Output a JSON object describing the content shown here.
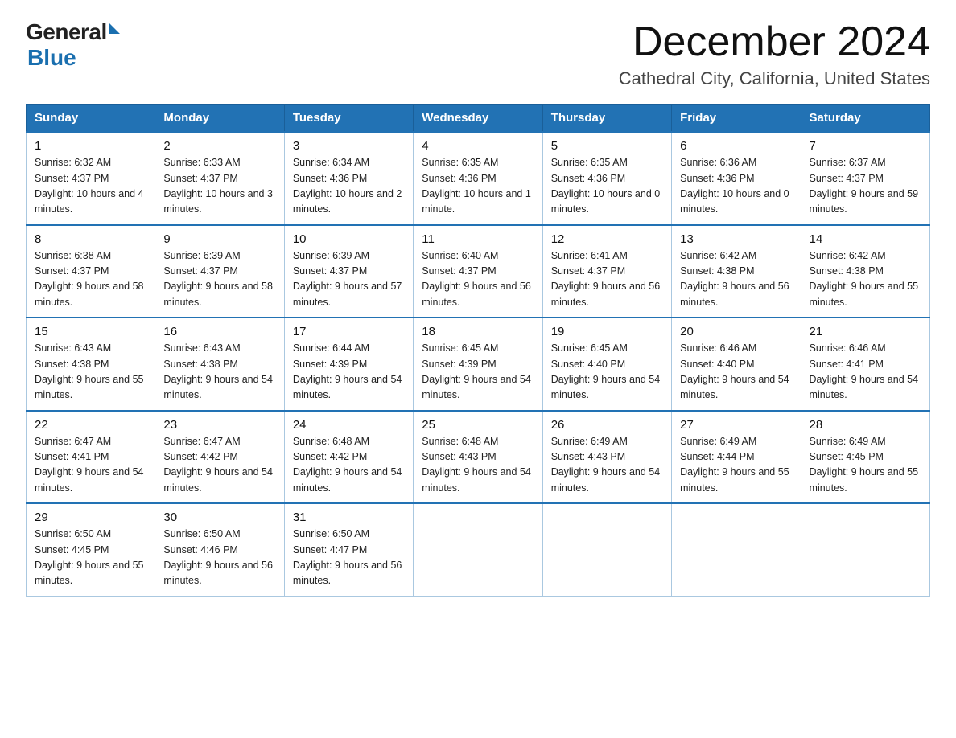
{
  "logo": {
    "general": "General",
    "blue": "Blue"
  },
  "header": {
    "month_title": "December 2024",
    "location": "Cathedral City, California, United States"
  },
  "weekdays": [
    "Sunday",
    "Monday",
    "Tuesday",
    "Wednesday",
    "Thursday",
    "Friday",
    "Saturday"
  ],
  "weeks": [
    [
      {
        "day": "1",
        "sunrise": "6:32 AM",
        "sunset": "4:37 PM",
        "daylight": "10 hours and 4 minutes."
      },
      {
        "day": "2",
        "sunrise": "6:33 AM",
        "sunset": "4:37 PM",
        "daylight": "10 hours and 3 minutes."
      },
      {
        "day": "3",
        "sunrise": "6:34 AM",
        "sunset": "4:36 PM",
        "daylight": "10 hours and 2 minutes."
      },
      {
        "day": "4",
        "sunrise": "6:35 AM",
        "sunset": "4:36 PM",
        "daylight": "10 hours and 1 minute."
      },
      {
        "day": "5",
        "sunrise": "6:35 AM",
        "sunset": "4:36 PM",
        "daylight": "10 hours and 0 minutes."
      },
      {
        "day": "6",
        "sunrise": "6:36 AM",
        "sunset": "4:36 PM",
        "daylight": "10 hours and 0 minutes."
      },
      {
        "day": "7",
        "sunrise": "6:37 AM",
        "sunset": "4:37 PM",
        "daylight": "9 hours and 59 minutes."
      }
    ],
    [
      {
        "day": "8",
        "sunrise": "6:38 AM",
        "sunset": "4:37 PM",
        "daylight": "9 hours and 58 minutes."
      },
      {
        "day": "9",
        "sunrise": "6:39 AM",
        "sunset": "4:37 PM",
        "daylight": "9 hours and 58 minutes."
      },
      {
        "day": "10",
        "sunrise": "6:39 AM",
        "sunset": "4:37 PM",
        "daylight": "9 hours and 57 minutes."
      },
      {
        "day": "11",
        "sunrise": "6:40 AM",
        "sunset": "4:37 PM",
        "daylight": "9 hours and 56 minutes."
      },
      {
        "day": "12",
        "sunrise": "6:41 AM",
        "sunset": "4:37 PM",
        "daylight": "9 hours and 56 minutes."
      },
      {
        "day": "13",
        "sunrise": "6:42 AM",
        "sunset": "4:38 PM",
        "daylight": "9 hours and 56 minutes."
      },
      {
        "day": "14",
        "sunrise": "6:42 AM",
        "sunset": "4:38 PM",
        "daylight": "9 hours and 55 minutes."
      }
    ],
    [
      {
        "day": "15",
        "sunrise": "6:43 AM",
        "sunset": "4:38 PM",
        "daylight": "9 hours and 55 minutes."
      },
      {
        "day": "16",
        "sunrise": "6:43 AM",
        "sunset": "4:38 PM",
        "daylight": "9 hours and 54 minutes."
      },
      {
        "day": "17",
        "sunrise": "6:44 AM",
        "sunset": "4:39 PM",
        "daylight": "9 hours and 54 minutes."
      },
      {
        "day": "18",
        "sunrise": "6:45 AM",
        "sunset": "4:39 PM",
        "daylight": "9 hours and 54 minutes."
      },
      {
        "day": "19",
        "sunrise": "6:45 AM",
        "sunset": "4:40 PM",
        "daylight": "9 hours and 54 minutes."
      },
      {
        "day": "20",
        "sunrise": "6:46 AM",
        "sunset": "4:40 PM",
        "daylight": "9 hours and 54 minutes."
      },
      {
        "day": "21",
        "sunrise": "6:46 AM",
        "sunset": "4:41 PM",
        "daylight": "9 hours and 54 minutes."
      }
    ],
    [
      {
        "day": "22",
        "sunrise": "6:47 AM",
        "sunset": "4:41 PM",
        "daylight": "9 hours and 54 minutes."
      },
      {
        "day": "23",
        "sunrise": "6:47 AM",
        "sunset": "4:42 PM",
        "daylight": "9 hours and 54 minutes."
      },
      {
        "day": "24",
        "sunrise": "6:48 AM",
        "sunset": "4:42 PM",
        "daylight": "9 hours and 54 minutes."
      },
      {
        "day": "25",
        "sunrise": "6:48 AM",
        "sunset": "4:43 PM",
        "daylight": "9 hours and 54 minutes."
      },
      {
        "day": "26",
        "sunrise": "6:49 AM",
        "sunset": "4:43 PM",
        "daylight": "9 hours and 54 minutes."
      },
      {
        "day": "27",
        "sunrise": "6:49 AM",
        "sunset": "4:44 PM",
        "daylight": "9 hours and 55 minutes."
      },
      {
        "day": "28",
        "sunrise": "6:49 AM",
        "sunset": "4:45 PM",
        "daylight": "9 hours and 55 minutes."
      }
    ],
    [
      {
        "day": "29",
        "sunrise": "6:50 AM",
        "sunset": "4:45 PM",
        "daylight": "9 hours and 55 minutes."
      },
      {
        "day": "30",
        "sunrise": "6:50 AM",
        "sunset": "4:46 PM",
        "daylight": "9 hours and 56 minutes."
      },
      {
        "day": "31",
        "sunrise": "6:50 AM",
        "sunset": "4:47 PM",
        "daylight": "9 hours and 56 minutes."
      },
      null,
      null,
      null,
      null
    ]
  ]
}
